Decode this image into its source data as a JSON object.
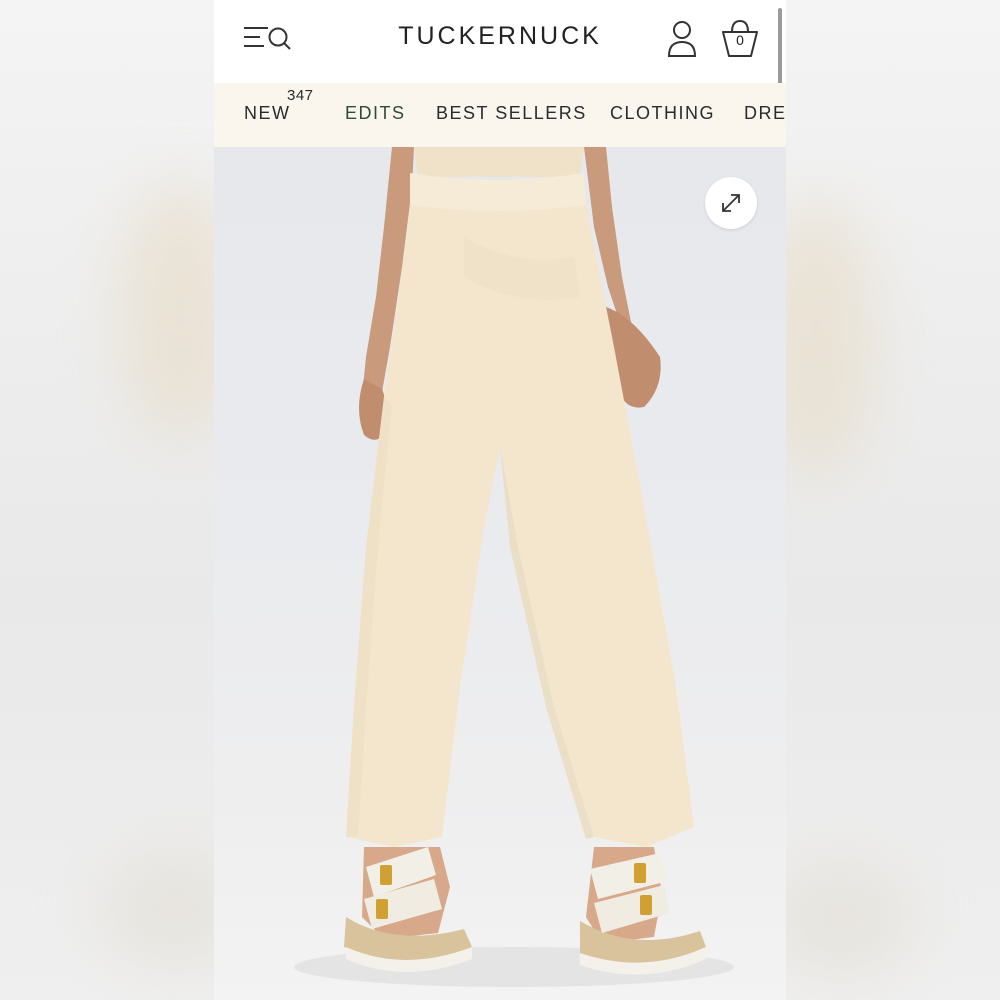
{
  "header": {
    "brand": "TUCKERNUCK",
    "bag_count": "0"
  },
  "nav": {
    "items": [
      {
        "label": "NEW",
        "badge": "347"
      },
      {
        "label": "EDITS"
      },
      {
        "label": "BEST SELLERS"
      },
      {
        "label": "CLOTHING"
      },
      {
        "label": "DRES"
      }
    ]
  },
  "icons": [
    "menu-search-icon",
    "account-icon",
    "shopping-bag-icon",
    "expand-icon"
  ],
  "colors": {
    "nav_background": "#faf6ee",
    "edits_accent": "#2f4b3a",
    "pants": "#f3e6cd"
  }
}
